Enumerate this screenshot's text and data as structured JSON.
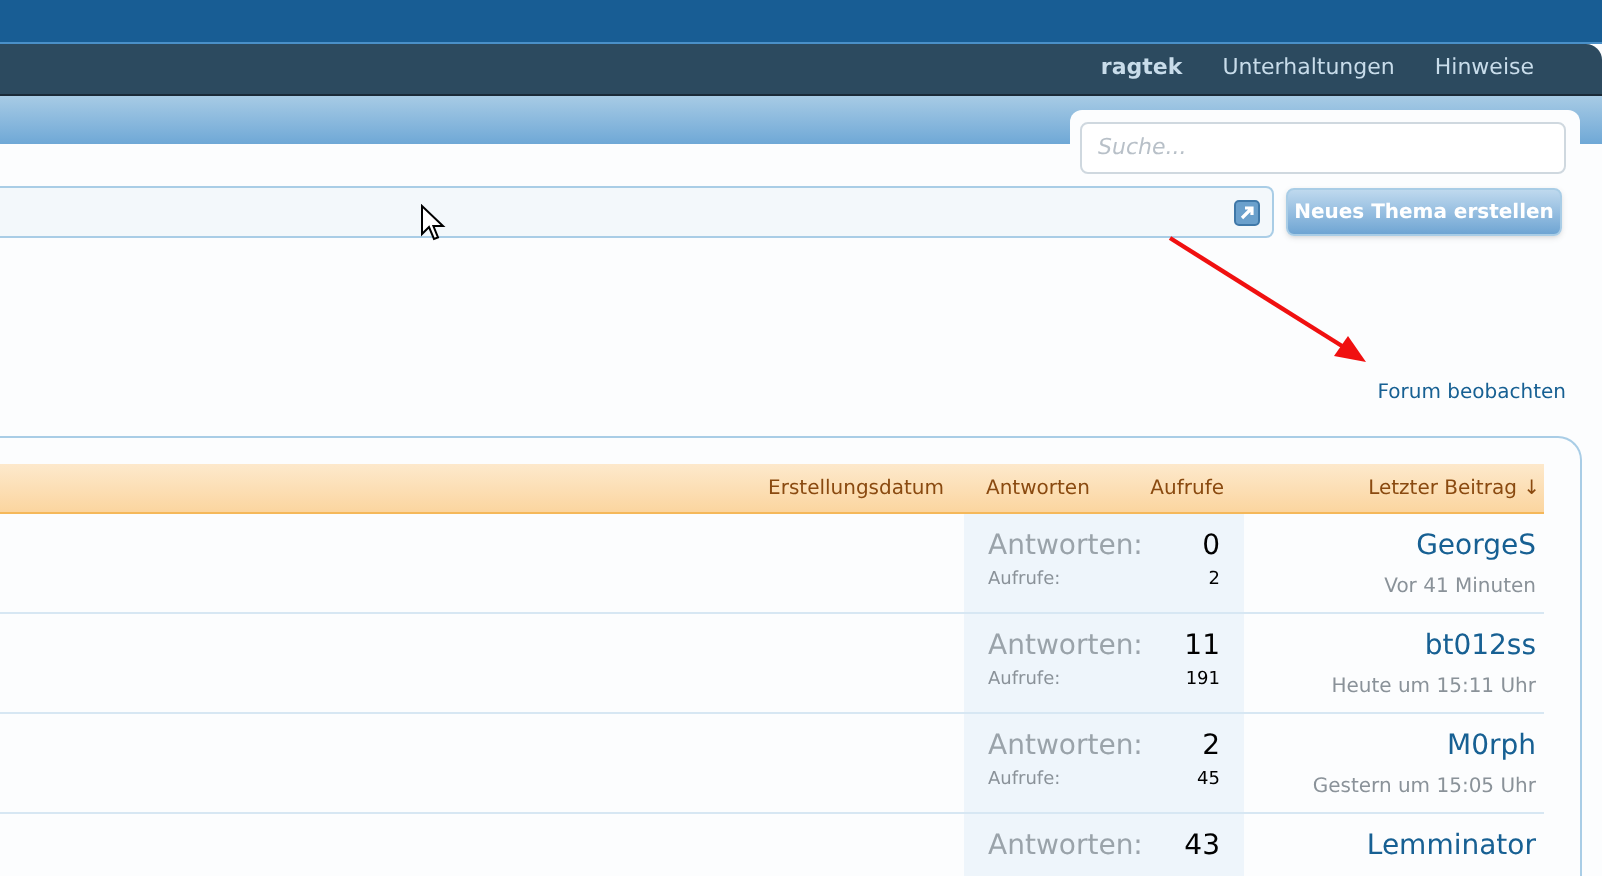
{
  "nav": {
    "items": [
      {
        "label": "ragtek"
      },
      {
        "label": "Unterhaltungen"
      },
      {
        "label": "Hinweise"
      }
    ]
  },
  "search": {
    "placeholder": "Suche..."
  },
  "new_thread_button": "Neues Thema erstellen",
  "watch_link": "Forum beobachten",
  "table": {
    "columns": [
      "Erstellungsdatum",
      "Antworten",
      "Aufrufe",
      "Letzter Beitrag ↓"
    ],
    "rows": [
      {
        "replies_label": "Antworten:",
        "replies": "0",
        "views_label": "Aufrufe:",
        "views": "2",
        "last_user": "GeorgeS",
        "last_time": "Vor 41 Minuten"
      },
      {
        "replies_label": "Antworten:",
        "replies": "11",
        "views_label": "Aufrufe:",
        "views": "191",
        "last_user": "bt012ss",
        "last_time": "Heute um 15:11 Uhr"
      },
      {
        "replies_label": "Antworten:",
        "replies": "2",
        "views_label": "Aufrufe:",
        "views": "45",
        "last_user": "M0rph",
        "last_time": "Gestern um 15:05 Uhr"
      },
      {
        "replies_label": "Antworten:",
        "replies": "43",
        "last_user": "Lemminator"
      }
    ]
  }
}
